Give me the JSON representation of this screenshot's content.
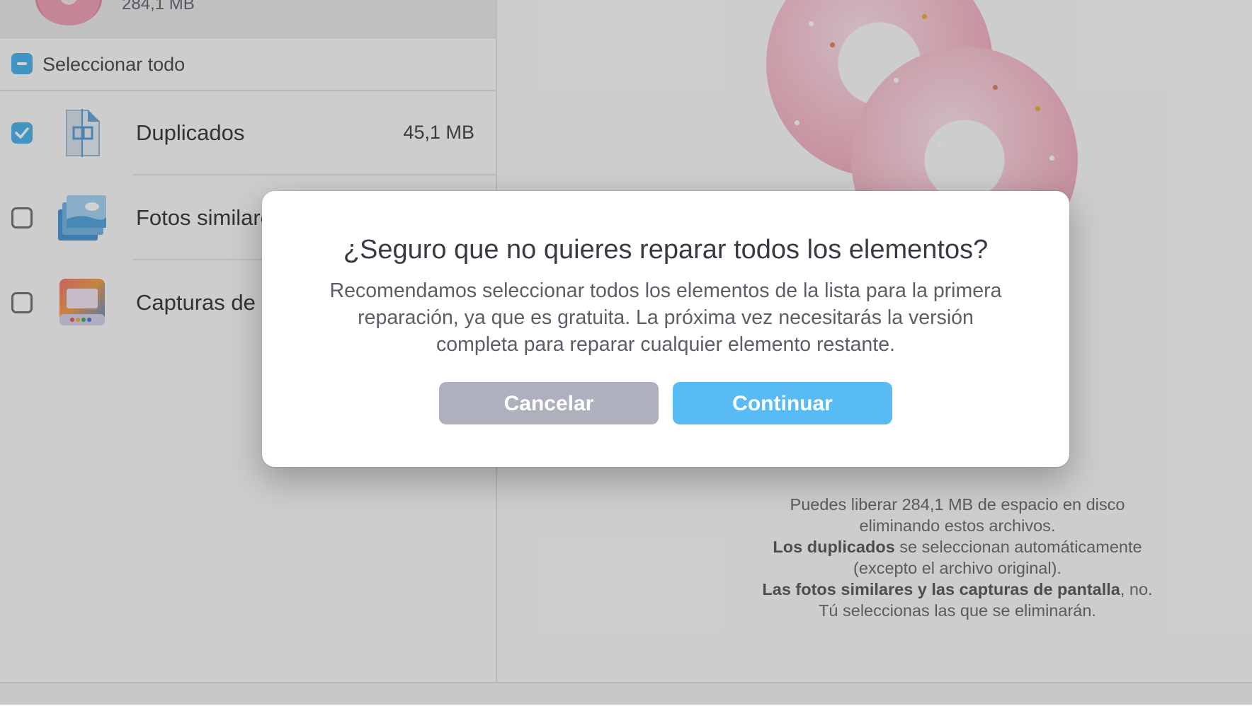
{
  "left_panel": {
    "header_size": "284,1 MB",
    "select_all_label": "Seleccionar todo",
    "items": [
      {
        "name": "Duplicados",
        "size": "45,1 MB",
        "checked": true,
        "icon": "duplicate-file-icon"
      },
      {
        "name": "Fotos similares",
        "size": "",
        "checked": false,
        "icon": "photos-stack-icon"
      },
      {
        "name": "Capturas de pantalla",
        "size": "",
        "checked": false,
        "icon": "screenshot-icon"
      }
    ]
  },
  "right_panel": {
    "info_line1": "Puedes liberar 284,1 MB de espacio en disco",
    "info_line2": "eliminando estos archivos.",
    "info_line3_bold": "Los duplicados",
    "info_line3_rest": " se seleccionan automáticamente",
    "info_line4": "(excepto el archivo original).",
    "info_line5_bold": "Las fotos similares y las capturas de pantalla",
    "info_line5_rest": ", no.",
    "info_line6": "Tú seleccionas las que se eliminarán."
  },
  "dialog": {
    "title": "¿Seguro que no quieres reparar todos los elementos?",
    "message": "Recomendamos seleccionar todos los elementos de la lista para la primera reparación, ya que es gratuita. La próxima vez necesitarás la versión completa para reparar cualquier elemento restante.",
    "cancel_label": "Cancelar",
    "continue_label": "Continuar"
  },
  "colors": {
    "accent": "#58bbf4",
    "cancel_button": "#aeb0be",
    "checkbox_checked": "#4fb6ee"
  }
}
